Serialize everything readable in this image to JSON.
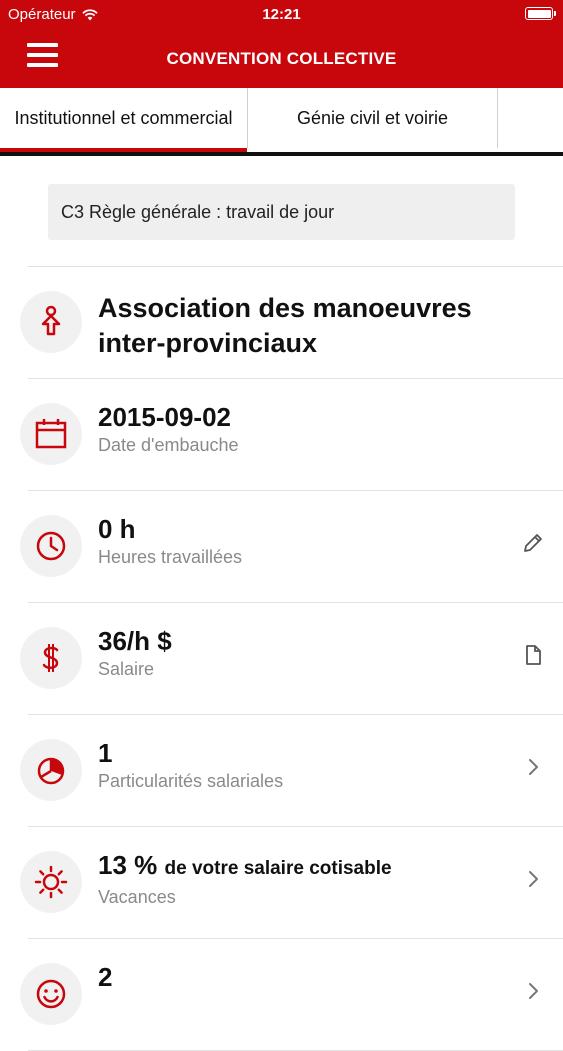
{
  "status_bar": {
    "carrier": "Opérateur",
    "time": "12:21"
  },
  "nav": {
    "title": "CONVENTION COLLECTIVE"
  },
  "tabs": [
    {
      "label": "Institutionnel et commercial",
      "selected": true
    },
    {
      "label": "Génie civil et voirie",
      "selected": false
    }
  ],
  "rule": {
    "label": "C3 Règle générale : travail de jour"
  },
  "items": [
    {
      "value": "Association des manoeuvres inter-provinciaux",
      "label": "",
      "icon": "person-arrow-icon",
      "action": ""
    },
    {
      "value": "2015-09-02",
      "label": "Date d'embauche",
      "icon": "calendar-icon",
      "action": ""
    },
    {
      "value": "0 h",
      "label": "Heures travaillées",
      "icon": "clock-icon",
      "action": "edit-pencil-icon"
    },
    {
      "value": "36/h $",
      "label": "Salaire",
      "icon": "dollar-icon",
      "action": "document-icon"
    },
    {
      "value": "1",
      "label": "Particularités salariales",
      "icon": "pie-chart-icon",
      "action": "chevron-right-icon"
    },
    {
      "value": "13 %",
      "value_suffix": "de votre salaire cotisable",
      "label": "Vacances",
      "icon": "sun-icon",
      "action": "chevron-right-icon"
    },
    {
      "value": "2",
      "label": "",
      "icon": "smiley-icon",
      "action": "chevron-right-icon"
    }
  ],
  "colors": {
    "accent": "#c8070d",
    "icon_bg": "#f1f1f1",
    "label_gray": "#8a8a8a"
  }
}
